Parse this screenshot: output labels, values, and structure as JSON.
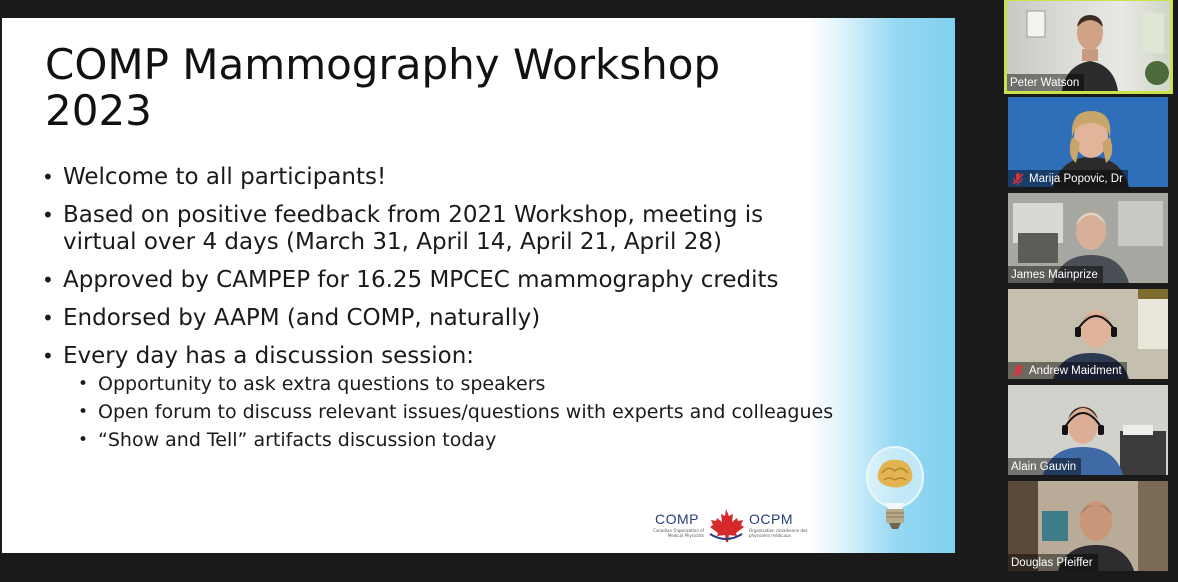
{
  "slide": {
    "title": "COMP Mammography Workshop 2023",
    "bullets": [
      "Welcome to all participants!",
      "Based on positive feedback from 2021 Workshop, meeting is virtual over 4 days (March 31, April 14, April 21, April 28)",
      "Approved by CAMPEP for 16.25 MPCEC mammography credits",
      "Endorsed by AAPM (and COMP, naturally)",
      "Every day has a discussion session:"
    ],
    "sub_bullets": [
      "Opportunity to ask extra questions to speakers",
      "Open forum to discuss relevant issues/questions with experts and colleagues",
      "“Show and Tell” artifacts discussion today"
    ],
    "logo": {
      "left": "COMP",
      "right": "OCPM",
      "left_sub": "Canadian Organization of Medical Physicists",
      "right_sub": "Organisation canadienne des physiciens médicaux"
    }
  },
  "participants": [
    {
      "name": "Peter Watson",
      "muted": false,
      "active": true
    },
    {
      "name": "Marija Popovic, Dr",
      "muted": true,
      "active": false
    },
    {
      "name": "James Mainprize",
      "muted": false,
      "active": false
    },
    {
      "name": "Andrew Maidment",
      "muted": true,
      "active": false
    },
    {
      "name": "Alain Gauvin",
      "muted": false,
      "active": false
    },
    {
      "name": "Douglas Pfeiffer",
      "muted": false,
      "active": false
    }
  ],
  "colors": {
    "active_speaker_border": "#c9e34d",
    "muted_mic": "#e0303a",
    "brand_blue": "#2a3d7a",
    "brand_red": "#d42a2a"
  }
}
